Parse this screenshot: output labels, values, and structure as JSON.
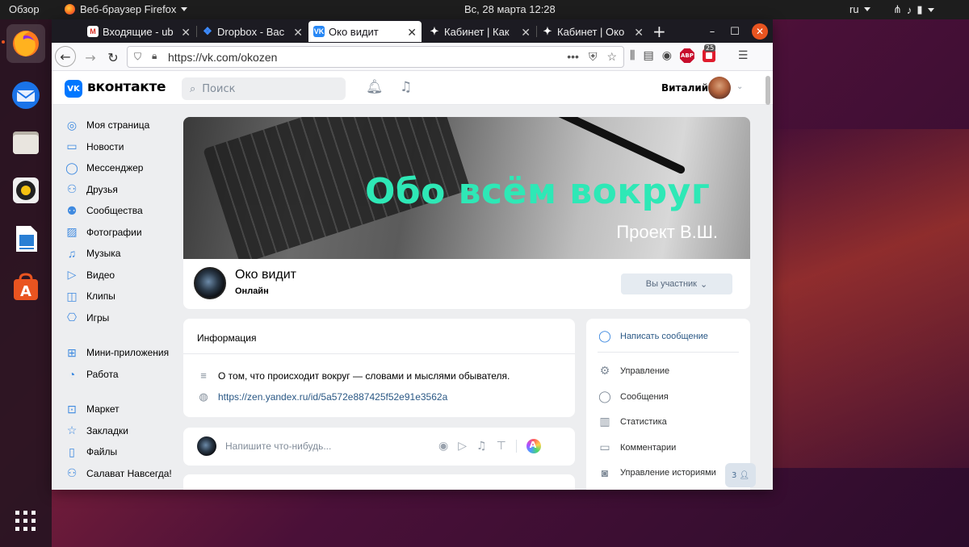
{
  "top_panel": {
    "overview": "Обзор",
    "app_name": "Веб-браузер Firefox",
    "clock": "Вс, 28 марта  12:28",
    "lang": "ru"
  },
  "dock": {
    "items": [
      "firefox-icon",
      "thunderbird-icon",
      "files-icon",
      "rhythmbox-icon",
      "libreoffice-writer-icon",
      "software-center-icon",
      "show-apps-icon"
    ]
  },
  "browser": {
    "tabs": [
      {
        "title": "Входящие - ub",
        "favicon": "gmail-icon"
      },
      {
        "title": "Dropbox - Вас",
        "favicon": "dropbox-icon"
      },
      {
        "title": "Око видит",
        "favicon": "vk-icon",
        "active": true
      },
      {
        "title": "Кабинет | Как",
        "favicon": "star-icon"
      },
      {
        "title": "Кабинет | Око",
        "favicon": "star-icon"
      }
    ],
    "url": "https://vk.com/okozen",
    "extension_badge": "25",
    "abp_label": "ABP"
  },
  "vk": {
    "logo_text": "вконтакте",
    "logo_badge": "VK",
    "search_placeholder": "Поиск",
    "user_name": "Виталий",
    "sidebar": [
      {
        "label": "Моя страница",
        "icon": "user-icon"
      },
      {
        "label": "Новости",
        "icon": "news-icon"
      },
      {
        "label": "Мессенджер",
        "icon": "message-icon"
      },
      {
        "label": "Друзья",
        "icon": "friends-icon"
      },
      {
        "label": "Сообщества",
        "icon": "communities-icon"
      },
      {
        "label": "Фотографии",
        "icon": "photo-icon"
      },
      {
        "label": "Музыка",
        "icon": "music-icon"
      },
      {
        "label": "Видео",
        "icon": "video-icon"
      },
      {
        "label": "Клипы",
        "icon": "clips-icon"
      },
      {
        "label": "Игры",
        "icon": "games-icon"
      }
    ],
    "sidebar_secondary": [
      {
        "label": "Мини-приложения",
        "icon": "apps-icon"
      },
      {
        "label": "Работа",
        "icon": "work-icon"
      }
    ],
    "sidebar_tertiary": [
      {
        "label": "Маркет",
        "icon": "market-icon"
      },
      {
        "label": "Закладки",
        "icon": "bookmark-icon"
      },
      {
        "label": "Файлы",
        "icon": "files-icon"
      },
      {
        "label": "Салават Навсегда!",
        "icon": "friends-icon"
      }
    ],
    "cover": {
      "title": "Обо всём вокруг",
      "subtitle": "Проект В.Ш."
    },
    "group": {
      "name": "Око видит",
      "status": "Онлайн",
      "member_button": "Вы участник"
    },
    "info": {
      "title": "Информация",
      "description": "О том, что происходит вокруг — словами и мыслями обывателя.",
      "link": "https://zen.yandex.ru/id/5a572e887425f52e91e3562a"
    },
    "post": {
      "placeholder": "Напишите что-нибудь..."
    },
    "actions": [
      {
        "label": "Написать сообщение",
        "icon": "message-icon"
      },
      {
        "label": "Управление",
        "icon": "gear-icon"
      },
      {
        "label": "Сообщения",
        "icon": "message-icon"
      },
      {
        "label": "Статистика",
        "icon": "stats-icon"
      },
      {
        "label": "Комментарии",
        "icon": "comment-icon"
      },
      {
        "label": "Управление историями",
        "icon": "stories-icon"
      }
    ],
    "members_count": "3"
  },
  "colors": {
    "vk_blue": "#0077ff",
    "link": "#2a5885",
    "cover_title": "#2ee8b6",
    "ubuntu_orange": "#e95420"
  }
}
